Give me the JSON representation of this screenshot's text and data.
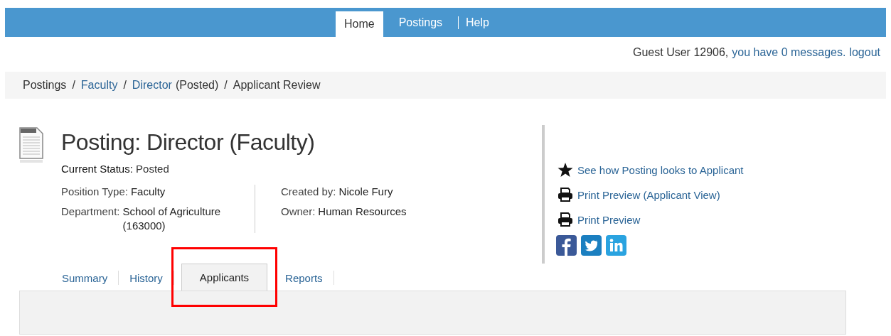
{
  "nav": [
    {
      "label": "Home",
      "selected": true
    },
    {
      "label": "Postings",
      "selected": false
    },
    {
      "label": "Help",
      "selected": false
    }
  ],
  "user_line": {
    "text": "Guest User 12906,",
    "messages_link": "you have 0 messages.",
    "logout_link": "logout"
  },
  "breadcrumb": [
    {
      "label": "Postings",
      "link": false
    },
    {
      "separator": "/",
      "label": "Faculty",
      "link": true
    },
    {
      "separator": "/",
      "label": "Director",
      "link": true,
      "suffix": "(Posted)"
    },
    {
      "separator": "/",
      "label": "Applicant Review",
      "link": false
    }
  ],
  "posting": {
    "title": "Posting: Director (Faculty)",
    "status": {
      "label": "Current Status:",
      "value": "Posted"
    },
    "left_fields": [
      {
        "label": "Position Type:",
        "value": "Faculty"
      },
      {
        "label": "Department:",
        "value": "School of Agriculture (163000)"
      }
    ],
    "right_fields": [
      {
        "label": "Created by:",
        "value": "Nicole Fury"
      },
      {
        "label": "Owner:",
        "value": "Human Resources"
      }
    ]
  },
  "actions": [
    {
      "kind": "star",
      "label": "See how Posting looks to Applicant"
    },
    {
      "kind": "print",
      "label": "Print Preview (Applicant View)"
    },
    {
      "kind": "print",
      "label": "Print Preview"
    }
  ],
  "social": [
    {
      "kind": "facebook"
    },
    {
      "kind": "twitter"
    },
    {
      "kind": "linkedin"
    }
  ],
  "tabs": [
    {
      "label": "Summary",
      "selected": false,
      "highlighted": false
    },
    {
      "label": "History",
      "selected": false,
      "highlighted": false
    },
    {
      "label": "Applicants",
      "selected": true,
      "highlighted": true
    },
    {
      "label": "Reports",
      "selected": false,
      "highlighted": false
    }
  ]
}
